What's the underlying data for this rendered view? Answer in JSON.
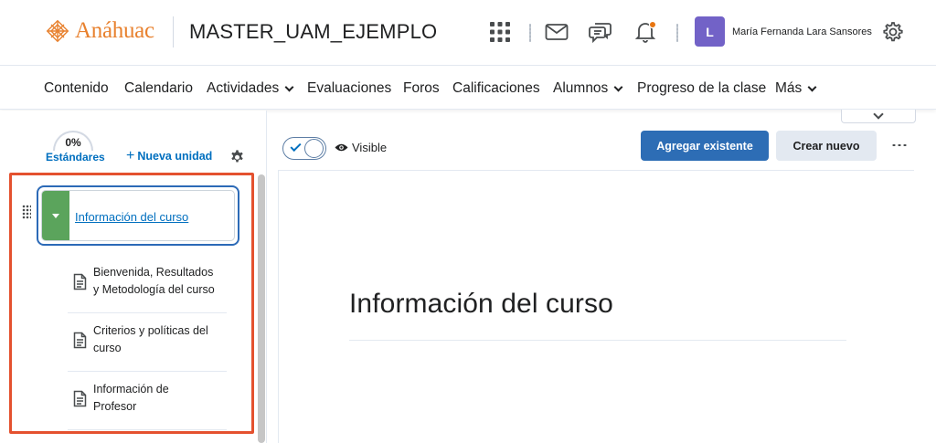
{
  "header": {
    "logo_text": "Anáhuac",
    "course_title": "MASTER_UAM_EJEMPLO",
    "user_initial": "L",
    "user_name": "María Fernanda Lara Sansores",
    "brand_color": "#e8812e",
    "avatar_color": "#7262c7",
    "icons": [
      "apps-grid-icon",
      "mail-icon",
      "chat-icon",
      "bell-icon",
      "gear-icon"
    ]
  },
  "nav": {
    "items": [
      {
        "label": "Contenido"
      },
      {
        "label": "Calendario"
      },
      {
        "label": "Actividades",
        "dropdown": true
      },
      {
        "label": "Evaluaciones"
      },
      {
        "label": "Foros"
      },
      {
        "label": "Calificaciones"
      },
      {
        "label": "Alumnos",
        "dropdown": true
      },
      {
        "label": "Progreso de la clase"
      },
      {
        "label": "Más",
        "dropdown": true
      }
    ]
  },
  "left": {
    "progress": "0%",
    "standards_label": "Estándares",
    "new_unit_label": "Nueva unidad",
    "unit": {
      "title": "Información del curso",
      "color": "#5ba45c"
    },
    "topics": [
      {
        "label": "Bienvenida, Resultados y Metodología del curso"
      },
      {
        "label": "Criterios y políticas del curso"
      },
      {
        "label": "Información de Profesor"
      }
    ],
    "highlight_color": "#e4512f"
  },
  "right": {
    "visibility_label": "Visible",
    "add_existing_label": "Agregar existente",
    "create_new_label": "Crear nuevo",
    "heading": "Información del curso",
    "primary_color": "#2d6db5"
  }
}
